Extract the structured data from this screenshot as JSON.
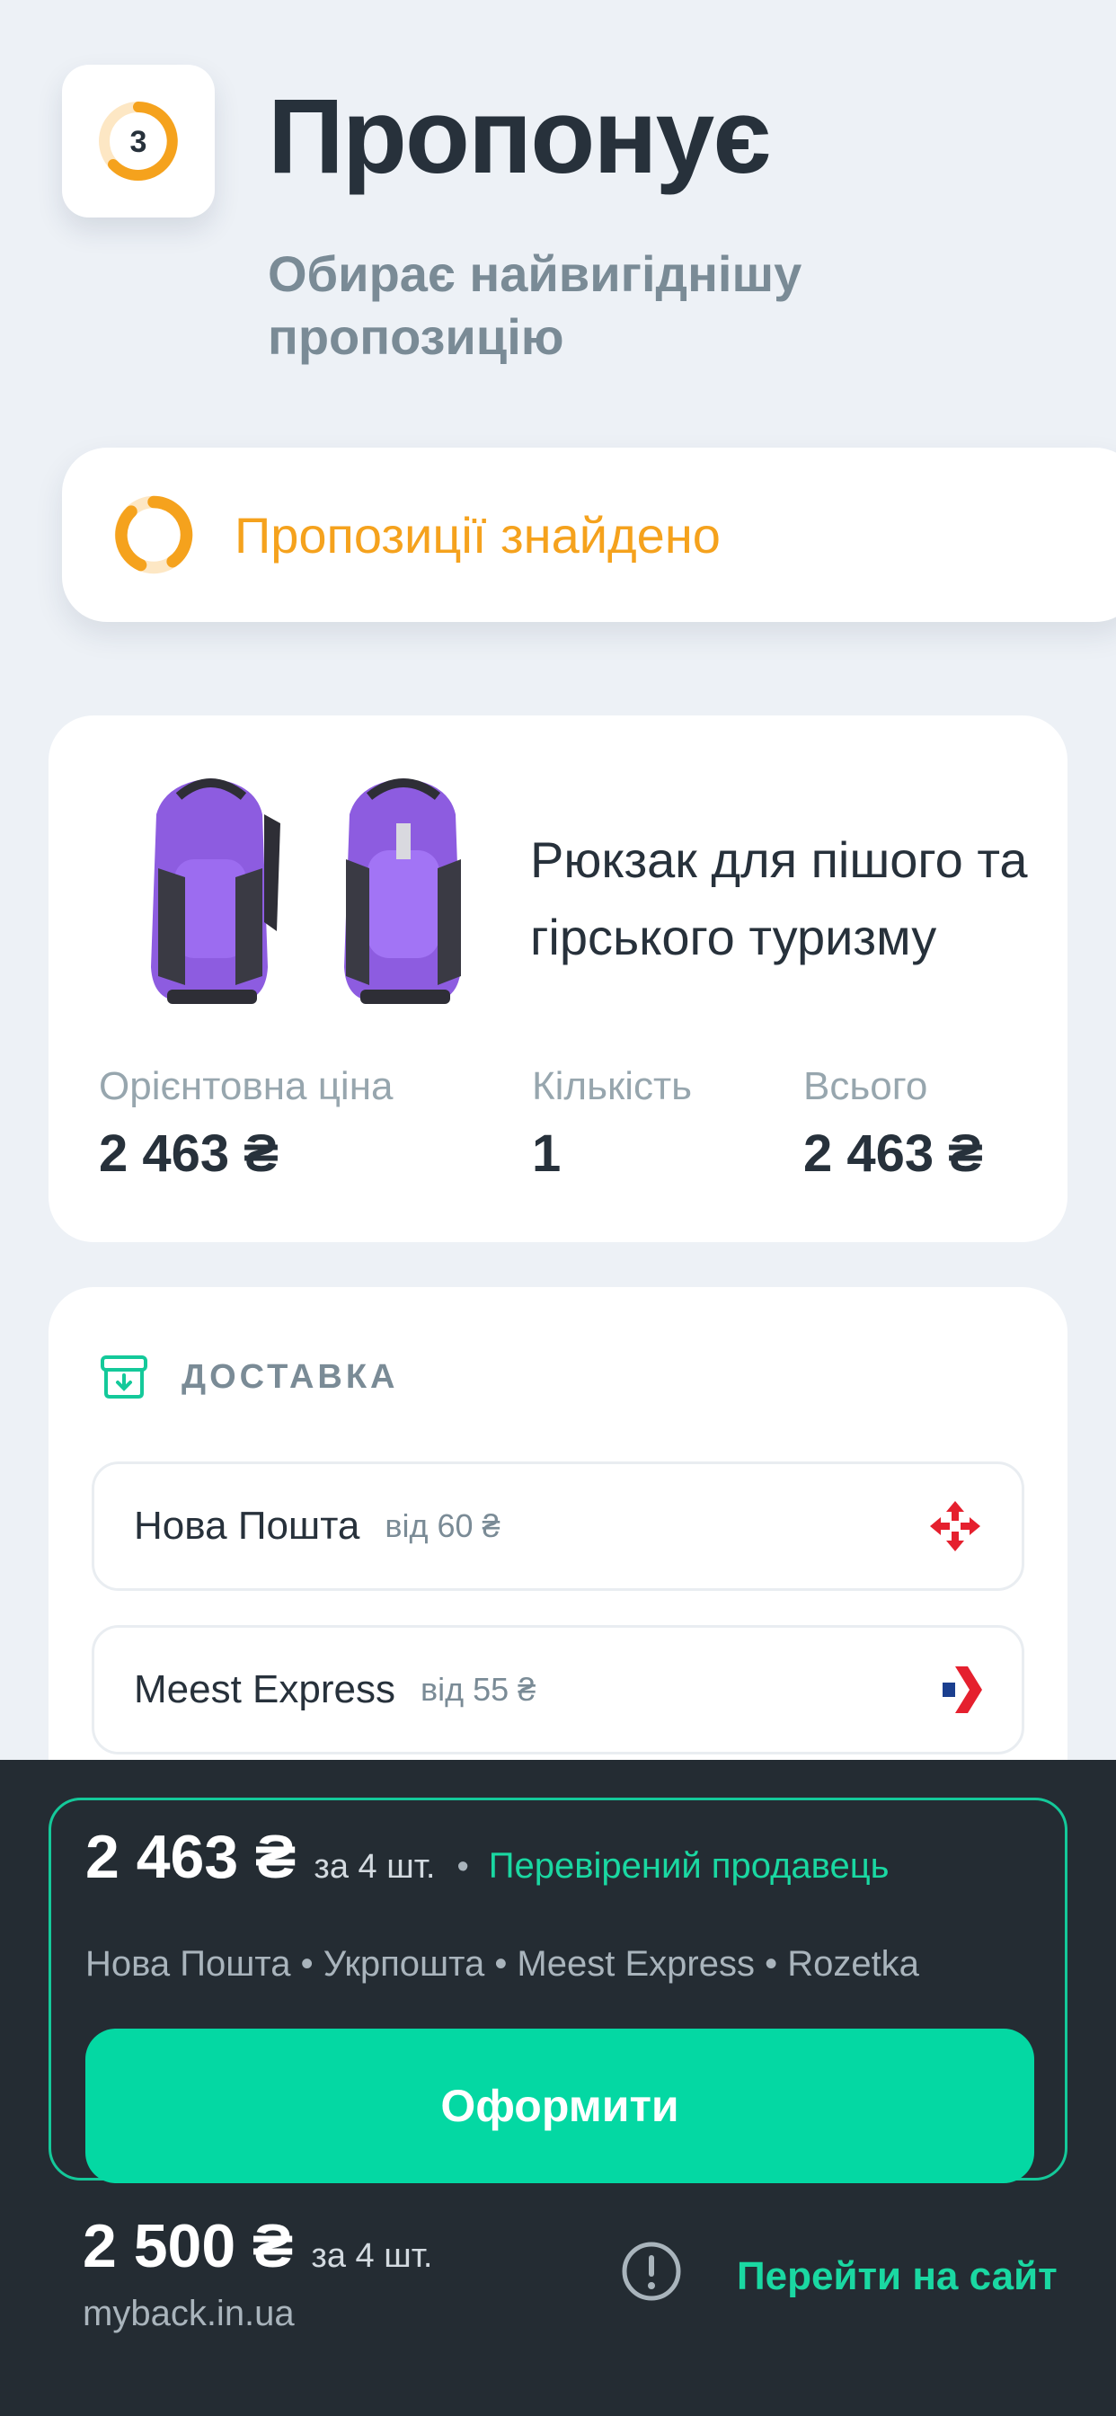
{
  "header": {
    "step_number": "3",
    "title": "Пропонує",
    "subtitle": "Обирає найвигіднішу пропозицію"
  },
  "status": {
    "text": "Пропозиції знайдено",
    "color": "#f5a21d"
  },
  "product": {
    "name": "Рюкзак для пішого та гірського туризму",
    "image_icon": "backpack-image",
    "stats": [
      {
        "label": "Орієнтовна ціна",
        "value": "2 463 ₴"
      },
      {
        "label": "Кількість",
        "value": "1"
      },
      {
        "label": "Всього",
        "value": "2 463 ₴"
      }
    ]
  },
  "delivery": {
    "title": "ДОСТАВКА",
    "carriers": [
      {
        "name": "Нова Пошта",
        "price": "від 60 ₴",
        "logo_icon": "nova-poshta-logo-icon"
      },
      {
        "name": "Meest Express",
        "price": "від 55 ₴",
        "logo_icon": "meest-logo-icon"
      }
    ]
  },
  "offer": {
    "price": "2 463 ₴",
    "quantity": "за 4 шт.",
    "separator": "•",
    "verified": "Перевірений продавець",
    "carriers_text": "Нова Пошта • Укрпошта • Meest Express • Rozetka",
    "button_label": "Оформити",
    "accent_color": "#04d8a3"
  },
  "alternative": {
    "price": "2 500 ₴",
    "quantity": "за 4 шт.",
    "domain": "myback.in.ua",
    "link_label": "Перейти на сайт"
  }
}
